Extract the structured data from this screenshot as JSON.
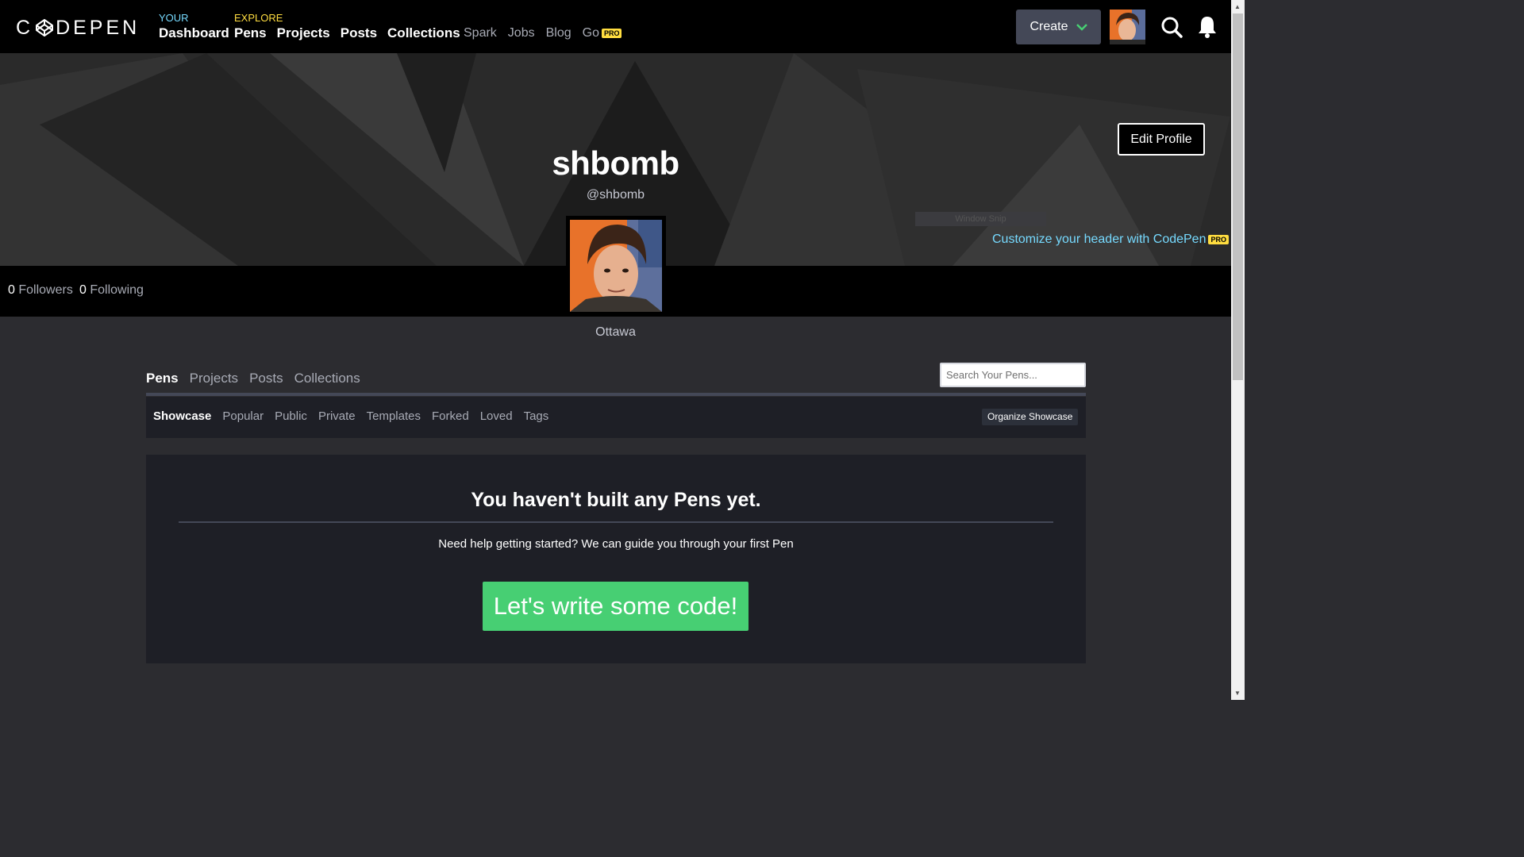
{
  "nav": {
    "logo_text": "DEPEN",
    "your_label": "YOUR",
    "explore_label": "EXPLORE",
    "dashboard": "Dashboard",
    "pens": "Pens",
    "projects": "Projects",
    "posts": "Posts",
    "collections": "Collections",
    "spark": "Spark",
    "jobs": "Jobs",
    "blog": "Blog",
    "go": "Go",
    "pro_badge": "PRO",
    "create": "Create"
  },
  "hero": {
    "edit_profile": "Edit Profile",
    "name": "shbomb",
    "handle": "@shbomb",
    "window_snip": "Window Snip",
    "customize": "Customize your header with CodePen",
    "pro_badge": "PRO"
  },
  "stats": {
    "followers_count": "0",
    "followers_label": "Followers",
    "following_count": "0",
    "following_label": "Following"
  },
  "location": "Ottawa",
  "tabs": [
    "Pens",
    "Projects",
    "Posts",
    "Collections"
  ],
  "search": {
    "placeholder": "Search Your Pens..."
  },
  "subtabs": [
    "Showcase",
    "Popular",
    "Public",
    "Private",
    "Templates",
    "Forked",
    "Loved",
    "Tags"
  ],
  "organize": "Organize Showcase",
  "empty": {
    "title": "You haven't built any Pens yet.",
    "help": "Need help getting started? We can guide you through your first Pen",
    "button": "Let's write some code!"
  },
  "colors": {
    "accent_blue": "#76daff",
    "accent_yellow": "#ffdd40",
    "cta_green": "#47cf73"
  }
}
